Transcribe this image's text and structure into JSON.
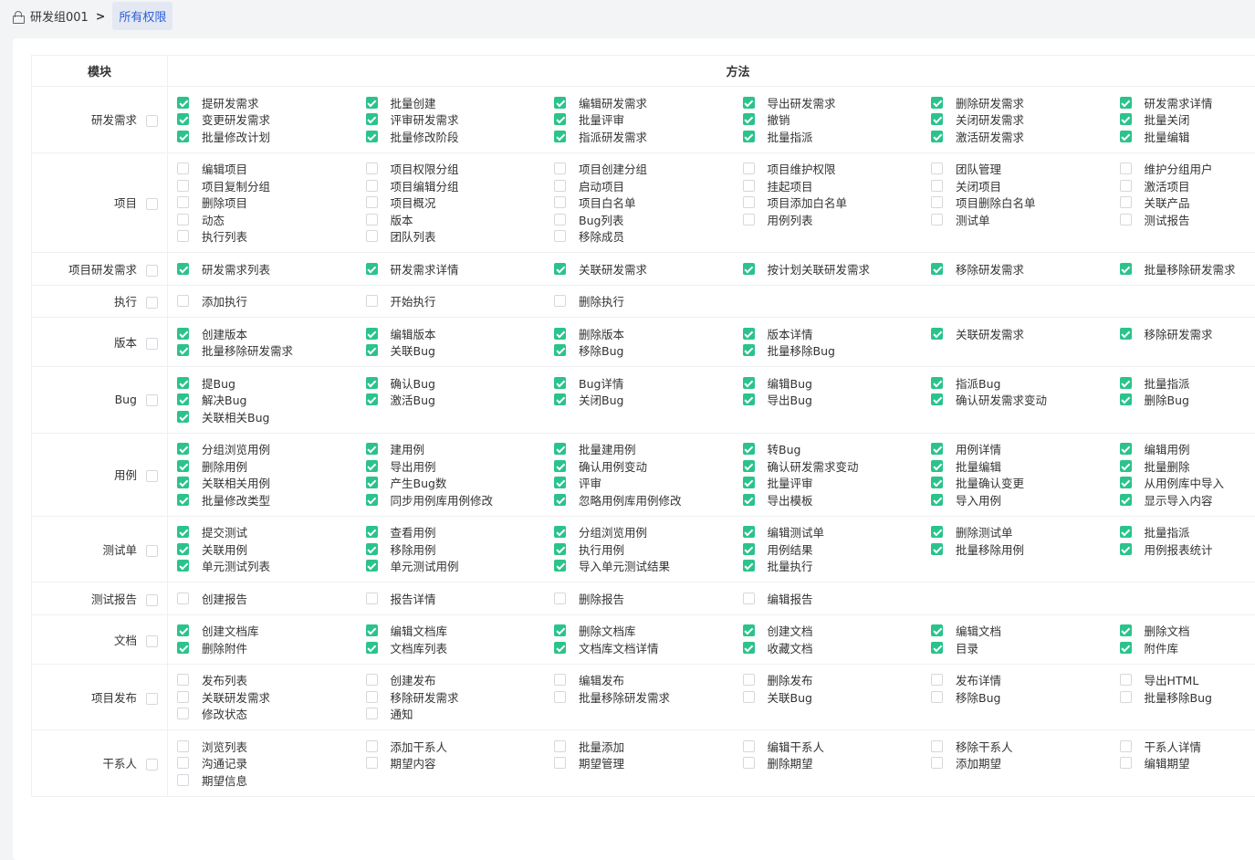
{
  "breadcrumb": {
    "group": "研发组001",
    "current": "所有权限"
  },
  "table": {
    "col_module": "模块",
    "col_methods": "方法"
  },
  "modules": [
    {
      "name": "研发需求",
      "checked": true,
      "items": [
        "提研发需求",
        "批量创建",
        "编辑研发需求",
        "导出研发需求",
        "删除研发需求",
        "研发需求详情",
        "变更研发需求",
        "评审研发需求",
        "批量评审",
        "撤销",
        "关闭研发需求",
        "批量关闭",
        "批量修改计划",
        "批量修改阶段",
        "指派研发需求",
        "批量指派",
        "激活研发需求",
        "批量编辑"
      ]
    },
    {
      "name": "项目",
      "checked": false,
      "items": [
        "编辑项目",
        "项目权限分组",
        "项目创建分组",
        "项目维护权限",
        "团队管理",
        "维护分组用户",
        "项目复制分组",
        "项目编辑分组",
        "启动项目",
        "挂起项目",
        "关闭项目",
        "激活项目",
        "删除项目",
        "项目概况",
        "项目白名单",
        "项目添加白名单",
        "项目删除白名单",
        "关联产品",
        "动态",
        "版本",
        "Bug列表",
        "用例列表",
        "测试单",
        "测试报告",
        "执行列表",
        "团队列表",
        "移除成员"
      ]
    },
    {
      "name": "项目研发需求",
      "checked": true,
      "items": [
        "研发需求列表",
        "研发需求详情",
        "关联研发需求",
        "按计划关联研发需求",
        "移除研发需求",
        "批量移除研发需求"
      ]
    },
    {
      "name": "执行",
      "checked": false,
      "items": [
        "添加执行",
        "开始执行",
        "删除执行"
      ]
    },
    {
      "name": "版本",
      "checked": true,
      "items": [
        "创建版本",
        "编辑版本",
        "删除版本",
        "版本详情",
        "关联研发需求",
        "移除研发需求",
        "批量移除研发需求",
        "关联Bug",
        "移除Bug",
        "批量移除Bug"
      ]
    },
    {
      "name": "Bug",
      "checked": true,
      "items": [
        "提Bug",
        "确认Bug",
        "Bug详情",
        "编辑Bug",
        "指派Bug",
        "批量指派",
        "解决Bug",
        "激活Bug",
        "关闭Bug",
        "导出Bug",
        "确认研发需求变动",
        "删除Bug",
        "关联相关Bug"
      ]
    },
    {
      "name": "用例",
      "checked": true,
      "items": [
        "分组浏览用例",
        "建用例",
        "批量建用例",
        "转Bug",
        "用例详情",
        "编辑用例",
        "删除用例",
        "导出用例",
        "确认用例变动",
        "确认研发需求变动",
        "批量编辑",
        "批量删除",
        "关联相关用例",
        "产生Bug数",
        "评审",
        "批量评审",
        "批量确认变更",
        "从用例库中导入",
        "批量修改类型",
        "同步用例库用例修改",
        "忽略用例库用例修改",
        "导出模板",
        "导入用例",
        "显示导入内容"
      ]
    },
    {
      "name": "测试单",
      "checked": true,
      "items": [
        "提交测试",
        "查看用例",
        "分组浏览用例",
        "编辑测试单",
        "删除测试单",
        "批量指派",
        "关联用例",
        "移除用例",
        "执行用例",
        "用例结果",
        "批量移除用例",
        "用例报表统计",
        "单元测试列表",
        "单元测试用例",
        "导入单元测试结果",
        "批量执行"
      ]
    },
    {
      "name": "测试报告",
      "checked": false,
      "items": [
        "创建报告",
        "报告详情",
        "删除报告",
        "编辑报告"
      ]
    },
    {
      "name": "文档",
      "checked": true,
      "items": [
        "创建文档库",
        "编辑文档库",
        "删除文档库",
        "创建文档",
        "编辑文档",
        "删除文档",
        "删除附件",
        "文档库列表",
        "文档库文档详情",
        "收藏文档",
        "目录",
        "附件库"
      ]
    },
    {
      "name": "项目发布",
      "checked": false,
      "items": [
        "发布列表",
        "创建发布",
        "编辑发布",
        "删除发布",
        "发布详情",
        "导出HTML",
        "关联研发需求",
        "移除研发需求",
        "批量移除研发需求",
        "关联Bug",
        "移除Bug",
        "批量移除Bug",
        "修改状态",
        "通知"
      ]
    },
    {
      "name": "干系人",
      "checked": false,
      "items": [
        "浏览列表",
        "添加干系人",
        "批量添加",
        "编辑干系人",
        "移除干系人",
        "干系人详情",
        "沟通记录",
        "期望内容",
        "期望管理",
        "删除期望",
        "添加期望",
        "编辑期望",
        "期望信息"
      ]
    }
  ]
}
